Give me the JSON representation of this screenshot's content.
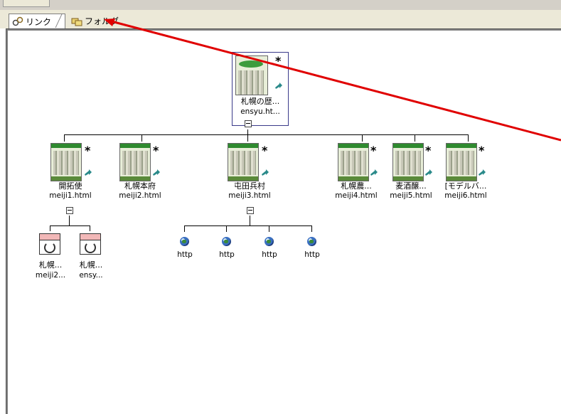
{
  "tabs": [
    {
      "label": "リンク",
      "icon": "link-icon",
      "active": true
    },
    {
      "label": "フォルダ",
      "icon": "folder-icon",
      "active": false
    }
  ],
  "root": {
    "title": "札幌の歴...",
    "file": "ensyu.ht..."
  },
  "children": [
    {
      "title": "開拓使",
      "file": "meiji1.html"
    },
    {
      "title": "札幌本府",
      "file": "meiji2.html"
    },
    {
      "title": "屯田兵村",
      "file": "meiji3.html"
    },
    {
      "title": "札幌農...",
      "file": "meiji4.html"
    },
    {
      "title": "麦酒醸...",
      "file": "meiji5.html"
    },
    {
      "title": "[モデルバ...",
      "file": "meiji6.html"
    }
  ],
  "broken_links": [
    {
      "title": "札幌...",
      "file": "meiji2..."
    },
    {
      "title": "札幌...",
      "file": "ensy..."
    }
  ],
  "external_links": [
    {
      "label": "http"
    },
    {
      "label": "http"
    },
    {
      "label": "http"
    },
    {
      "label": "http"
    }
  ],
  "colors": {
    "annotation_arrow": "#e00000",
    "thumb_header": "#2f8a2f"
  }
}
